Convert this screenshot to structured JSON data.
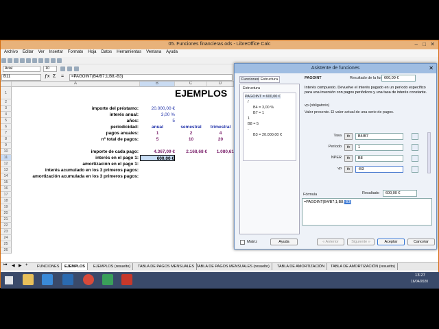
{
  "window": {
    "title": "05. Funciones financieras.ods - LibreOffice Calc"
  },
  "menu": [
    "Archivo",
    "Editar",
    "Ver",
    "Insertar",
    "Formato",
    "Hoja",
    "Datos",
    "Herramientas",
    "Ventana",
    "Ayuda"
  ],
  "toolbar": {
    "font_name": "Arial",
    "font_size": "10"
  },
  "formula_bar": {
    "name_box": "B11",
    "formula": "=PAGOINT(B4/B7;1;B8;-B3)"
  },
  "grid": {
    "columns": [
      "A",
      "B",
      "C",
      "D"
    ],
    "rows": [
      "1",
      "2",
      "3",
      "4",
      "5",
      "6",
      "7",
      "8",
      "9",
      "10",
      "11",
      "12",
      "13",
      "14",
      "15",
      "16",
      "17",
      "18",
      "19",
      "20",
      "21",
      "22",
      "23",
      "24",
      "25",
      "26"
    ],
    "title": "EJEMPLOS",
    "labels": {
      "r3": "importe del préstamo:",
      "r4": "interés anual:",
      "r5": "años:",
      "r6": "periodicidad:",
      "r7": "pagos anuales:",
      "r8": "nº total de pagos:",
      "r10": "importe de cada pago:",
      "r11": "interés en el pago 1:",
      "r12": "amortización en el pago 1:",
      "r13": "interés acumulado en los 3 primeros pagos:",
      "r14": "amortización acumulada en los 3 primeros pagos:"
    },
    "values": {
      "b3": "20.000,00 €",
      "b4": "3,00 %",
      "b5": "5",
      "b6": "anual",
      "c6": "semestral",
      "d6": "trimestral",
      "b7": "1",
      "c7": "2",
      "d7": "4",
      "b8": "5",
      "c8": "10",
      "d8": "20",
      "b10": "4.367,09 €",
      "c10": "2.168,68 €",
      "d10": "1.080,61",
      "b11": "600,00 €"
    }
  },
  "sheet_tabs": [
    "FUNCIONES",
    "EJEMPLOS",
    "EJEMPLOS (resuelto)",
    "TABLA DE PAGOS MENSUALES",
    "TABLA DE PAGOS MENSUALES (resuelto)",
    "TABLA DE AMORTIZACIÓN",
    "TABLA DE AMORTIZACIÓN (resuelto)"
  ],
  "dialog": {
    "title": "Asistente de funciones",
    "tabs": [
      "Funciones",
      "Estructura"
    ],
    "structure_label": "Estructura",
    "tree": [
      "PAGOINT = 600,00 €",
      "/",
      "B4 = 3,00 %",
      "B7 = 1",
      "1",
      "B8 = 5",
      "-",
      "B3 = 20.000,00 €"
    ],
    "function_name": "PAGOINT",
    "result_label": "Resultado de la función",
    "result_value": "600,00 €",
    "description": "Interés compuesto. Devuelve el interés pagado en un período específico para una inversión con pagos periódicos y una tasa de interés constante.",
    "param_name": "vp (obligatorio)",
    "param_desc": "Valor presente. El valor actual de una serie de pagos.",
    "args": [
      {
        "label": "Tasa",
        "value": "B4/B7"
      },
      {
        "label": "Período",
        "value": "1"
      },
      {
        "label": "NPER",
        "value": "B8"
      },
      {
        "label": "vp",
        "value": "-B3"
      }
    ],
    "formula_label": "Fórmula",
    "result2_label": "Resultado",
    "result2_value": "600,00 €",
    "formula_text": "=PAGOINT(B4/B7;1;B8;",
    "formula_sel": "-B3)",
    "matrix_label": "Matriz",
    "buttons": {
      "help": "Ayuda",
      "back": "« Anterior",
      "next": "Siguiente »",
      "accept": "Aceptar",
      "cancel": "Cancelar"
    }
  },
  "taskbar": {
    "time": "13:27",
    "date": "16/04/2020"
  }
}
